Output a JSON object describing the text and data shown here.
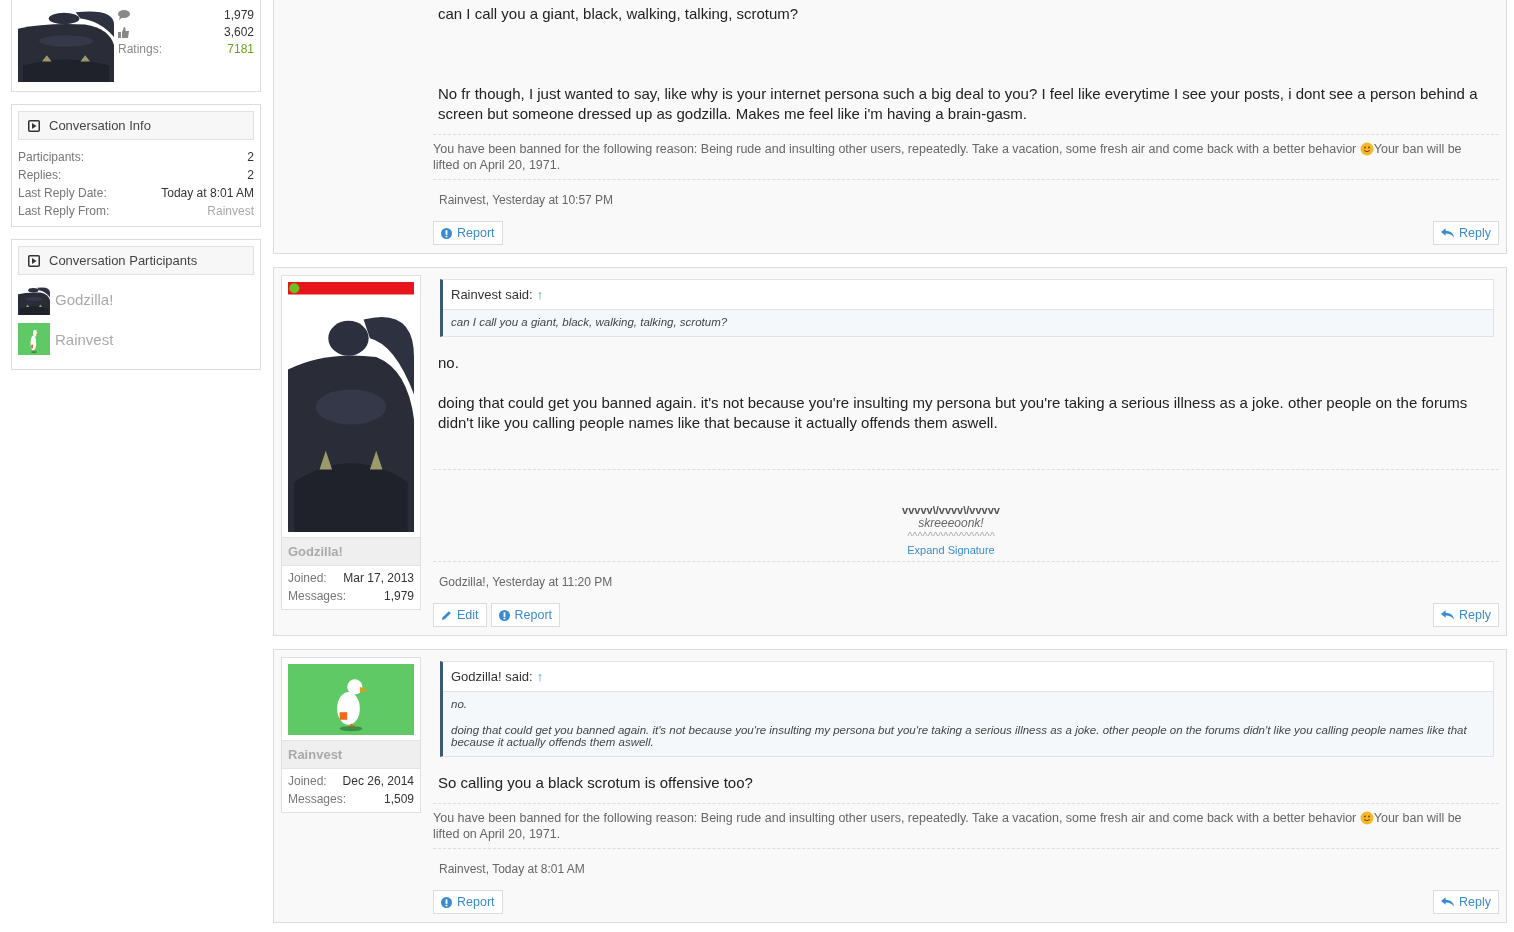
{
  "sidebar": {
    "profile": {
      "stats": [
        {
          "kind": "messages",
          "value": "1,979"
        },
        {
          "kind": "likes",
          "value": "3,602"
        },
        {
          "kind": "ratings",
          "label": "Ratings:",
          "value": "7181"
        }
      ]
    },
    "conversation_info": {
      "title": "Conversation Info",
      "rows": [
        {
          "label": "Participants:",
          "value": "2",
          "kind": "plain"
        },
        {
          "label": "Replies:",
          "value": "2",
          "kind": "plain"
        },
        {
          "label": "Last Reply Date:",
          "value": "Today at 8:01 AM",
          "kind": "plain"
        },
        {
          "label": "Last Reply From:",
          "value": "Rainvest",
          "kind": "user"
        }
      ]
    },
    "participants": {
      "title": "Conversation Participants",
      "items": [
        {
          "name": "Godzilla!"
        },
        {
          "name": "Rainvest"
        }
      ]
    }
  },
  "posts": [
    {
      "paragraphs": [
        "can I call you a giant, black, walking, talking, scrotum?",
        "No fr though, I just wanted to say, like why is your internet persona such a big deal to you? I feel like everytime I see your posts, i dont see a person behind a screen but someone dressed up as godzilla. Makes me feel like i'm having a brain-gasm."
      ],
      "ban_notice": {
        "before": "You have been banned for the following reason: Being rude and insulting other users, repeatedly. Take a vacation, some fresh air and come back with a better behavior",
        "after": "Your ban will be lifted on April 20, 1971."
      },
      "meta": "Rainvest, Yesterday at 10:57 PM",
      "actions": [
        {
          "kind": "report",
          "label": "Report"
        }
      ],
      "reply": "Reply"
    },
    {
      "author": {
        "name": "Godzilla!",
        "joined_label": "Joined:",
        "joined": "Mar 17, 2013",
        "messages_label": "Messages:",
        "messages": "1,979"
      },
      "quote": {
        "author": "Rainvest said:",
        "arrow": "↑",
        "paragraphs": [
          "can I call you a giant, black, walking, talking, scrotum?"
        ]
      },
      "paragraphs": [
        "no.",
        "doing that could get you banned again. it's not because you're insulting my persona but you're taking a serious illness as a joke. other people on the forums didn't like you calling people names like that because it actually offends them aswell."
      ],
      "signature": {
        "lines": [
          "vvvvv\\/vvvv\\/vvvvv",
          "skreeeoonk!",
          "^^^^^^^^^^^^^^^^^"
        ],
        "expand": "Expand Signature"
      },
      "meta": "Godzilla!, Yesterday at 11:20 PM",
      "actions": [
        {
          "kind": "edit",
          "label": "Edit"
        },
        {
          "kind": "report",
          "label": "Report"
        }
      ],
      "reply": "Reply"
    },
    {
      "author": {
        "name": "Rainvest",
        "joined_label": "Joined:",
        "joined": "Dec 26, 2014",
        "messages_label": "Messages:",
        "messages": "1,509"
      },
      "quote": {
        "author": "Godzilla! said:",
        "arrow": "↑",
        "paragraphs": [
          "no.",
          "doing that could get you banned again. it's not because you're insulting my persona but you're taking a serious illness as a joke. other people on the forums didn't like you calling people names like that because it actually offends them aswell."
        ]
      },
      "paragraphs": [
        "So calling you a black scrotum is offensive too?"
      ],
      "ban_notice": {
        "before": "You have been banned for the following reason: Being rude and insulting other users, repeatedly. Take a vacation, some fresh air and come back with a better behavior",
        "after": "Your ban will be lifted on April 20, 1971."
      },
      "meta": "Rainvest, Today at 8:01 AM",
      "actions": [
        {
          "kind": "report",
          "label": "Report"
        }
      ],
      "reply": "Reply"
    }
  ]
}
